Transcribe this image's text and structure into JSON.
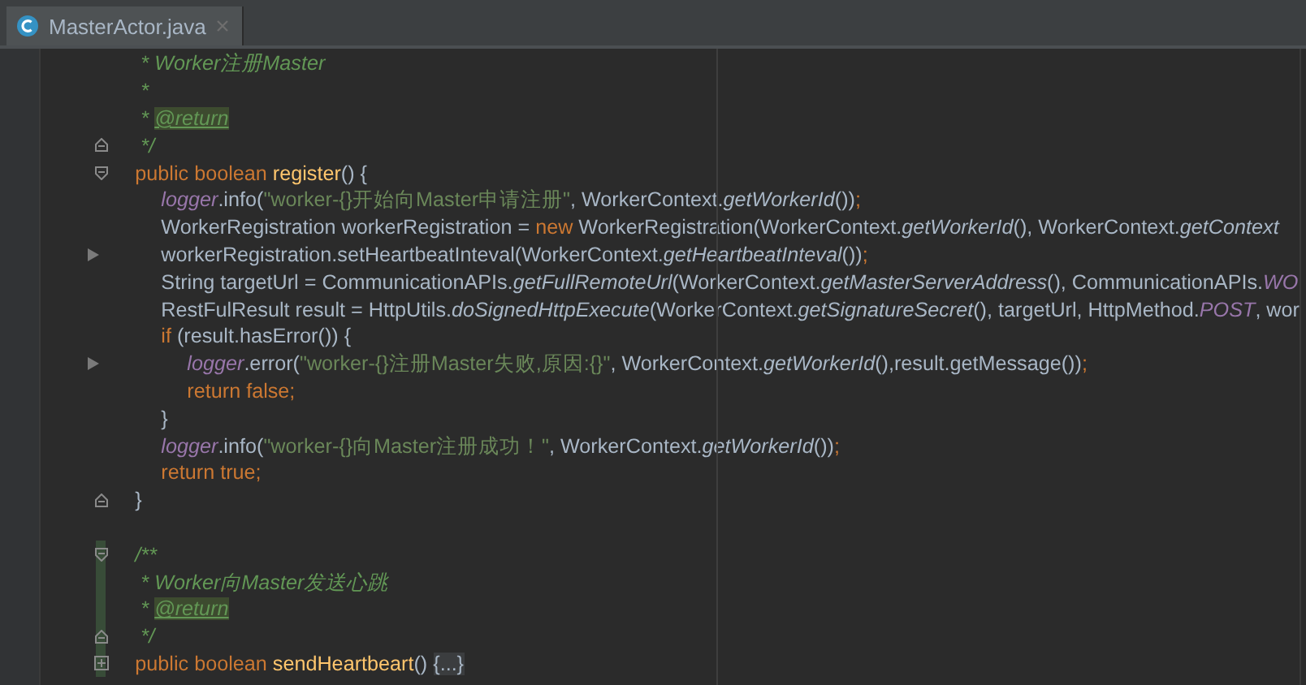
{
  "tabs": [
    {
      "label": "MasterActor.java",
      "selected": true
    }
  ],
  "lines": [
    {
      "tokens": [
        {
          "text": " * Worker注册Master",
          "kind": "doc"
        }
      ],
      "changed": false
    },
    {
      "tokens": [
        {
          "text": " *",
          "kind": "doc"
        }
      ],
      "changed": false
    },
    {
      "tokens": [
        {
          "text": " * ",
          "kind": "doc"
        },
        {
          "text": "@return",
          "kind": "doctag"
        }
      ],
      "changed": false
    },
    {
      "tokens": [
        {
          "text": " */",
          "kind": "doc"
        }
      ],
      "gutter": {
        "kind": "fold-end"
      },
      "changed": false
    },
    {
      "tokens": [
        {
          "text": "public boolean ",
          "kind": "keyword"
        },
        {
          "text": "register",
          "kind": "decl"
        },
        {
          "text": "() {",
          "kind": "plain"
        }
      ],
      "gutter": {
        "kind": "fold-start"
      },
      "changed": false,
      "children": [
        {
          "tokens": [
            {
              "text": "logger",
              "kind": "field"
            },
            {
              "text": ".info(",
              "kind": "plain"
            },
            {
              "text": "\"worker-{}开始向Master申请注册\"",
              "kind": "string"
            },
            {
              "text": ", WorkerContext.",
              "kind": "plain"
            },
            {
              "text": "getWorkerId",
              "kind": "static"
            },
            {
              "text": "())",
              "kind": "plain"
            },
            {
              "text": ";",
              "kind": "keyword"
            }
          ],
          "changed": false
        },
        {
          "tokens": [
            {
              "text": "WorkerRegistration workerRegistration = ",
              "kind": "plain"
            },
            {
              "text": "new ",
              "kind": "keyword"
            },
            {
              "text": "WorkerRegistration(WorkerContext.",
              "kind": "plain"
            },
            {
              "text": "getWorkerId",
              "kind": "static"
            },
            {
              "text": "(), WorkerContext.",
              "kind": "plain"
            },
            {
              "text": "getContext",
              "kind": "static"
            }
          ],
          "changed": false
        },
        {
          "tokens": [
            {
              "text": "workerRegistration.setHeartbeatInteval(WorkerContext.",
              "kind": "plain"
            },
            {
              "text": "getHeartbeatInteval",
              "kind": "static"
            },
            {
              "text": "())",
              "kind": "plain"
            },
            {
              "text": ";",
              "kind": "keyword"
            }
          ],
          "gutter": {
            "kind": "arrow"
          },
          "changed": false
        },
        {
          "tokens": [
            {
              "text": "String targetUrl = CommunicationAPIs.",
              "kind": "plain"
            },
            {
              "text": "getFullRemoteUrl",
              "kind": "static"
            },
            {
              "text": "(WorkerContext.",
              "kind": "plain"
            },
            {
              "text": "getMasterServerAddress",
              "kind": "static"
            },
            {
              "text": "(), CommunicationAPIs.",
              "kind": "plain"
            },
            {
              "text": "WO",
              "kind": "field"
            }
          ],
          "changed": false
        },
        {
          "tokens": [
            {
              "text": "RestFulResult result = HttpUtils.",
              "kind": "plain"
            },
            {
              "text": "doSignedHttpExecute",
              "kind": "static"
            },
            {
              "text": "(WorkerContext.",
              "kind": "plain"
            },
            {
              "text": "getSignatureSecret",
              "kind": "static"
            },
            {
              "text": "(), targetUrl, HttpMethod.",
              "kind": "plain"
            },
            {
              "text": "POST",
              "kind": "field"
            },
            {
              "text": ", wor",
              "kind": "plain"
            }
          ],
          "changed": false
        },
        {
          "tokens": [
            {
              "text": "if ",
              "kind": "keyword"
            },
            {
              "text": "(result.hasError()) {",
              "kind": "plain"
            }
          ],
          "changed": false,
          "children": [
            {
              "tokens": [
                {
                  "text": "logger",
                  "kind": "field"
                },
                {
                  "text": ".error(",
                  "kind": "plain"
                },
                {
                  "text": "\"worker-{}注册Master失败,原因:{}\"",
                  "kind": "string"
                },
                {
                  "text": ", WorkerContext.",
                  "kind": "plain"
                },
                {
                  "text": "getWorkerId",
                  "kind": "static"
                },
                {
                  "text": "(),result.getMessage())",
                  "kind": "plain"
                },
                {
                  "text": ";",
                  "kind": "keyword"
                }
              ],
              "gutter": {
                "kind": "arrow"
              },
              "changed": false
            },
            {
              "tokens": [
                {
                  "text": "return false;",
                  "kind": "keyword"
                }
              ],
              "changed": false
            }
          ]
        },
        {
          "tokens": [
            {
              "text": "}",
              "kind": "plain"
            }
          ],
          "changed": false
        },
        {
          "tokens": [
            {
              "text": "logger",
              "kind": "field"
            },
            {
              "text": ".info(",
              "kind": "plain"
            },
            {
              "text": "\"worker-{}向Master注册成功！\"",
              "kind": "string"
            },
            {
              "text": ", WorkerContext.",
              "kind": "plain"
            },
            {
              "text": "getWorkerId",
              "kind": "static"
            },
            {
              "text": "())",
              "kind": "plain"
            },
            {
              "text": ";",
              "kind": "keyword"
            }
          ],
          "changed": false
        },
        {
          "tokens": [
            {
              "text": "return true;",
              "kind": "keyword"
            }
          ],
          "changed": false
        }
      ]
    },
    {
      "tokens": [
        {
          "text": "}",
          "kind": "plain"
        }
      ],
      "gutter": {
        "kind": "fold-end"
      },
      "changed": false
    },
    {
      "changed": false
    },
    {
      "tokens": [
        {
          "text": "/**",
          "kind": "doc"
        }
      ],
      "gutter": {
        "kind": "fold-start"
      },
      "changed": true
    },
    {
      "tokens": [
        {
          "text": " * Worker向Master发送心跳",
          "kind": "doc"
        }
      ],
      "changed": true
    },
    {
      "tokens": [
        {
          "text": " * ",
          "kind": "doc"
        },
        {
          "text": "@return",
          "kind": "doctag"
        }
      ],
      "changed": true
    },
    {
      "tokens": [
        {
          "text": " */",
          "kind": "doc"
        }
      ],
      "gutter": {
        "kind": "fold-end"
      },
      "changed": true
    },
    {
      "tokens": [
        {
          "text": "public boolean ",
          "kind": "keyword"
        },
        {
          "text": "sendHeartbeart",
          "kind": "decl"
        },
        {
          "text": "() ",
          "kind": "plain"
        },
        {
          "text": "{...}",
          "kind": "folded"
        }
      ],
      "gutter": {
        "kind": "collapsed"
      },
      "changed": true
    }
  ]
}
